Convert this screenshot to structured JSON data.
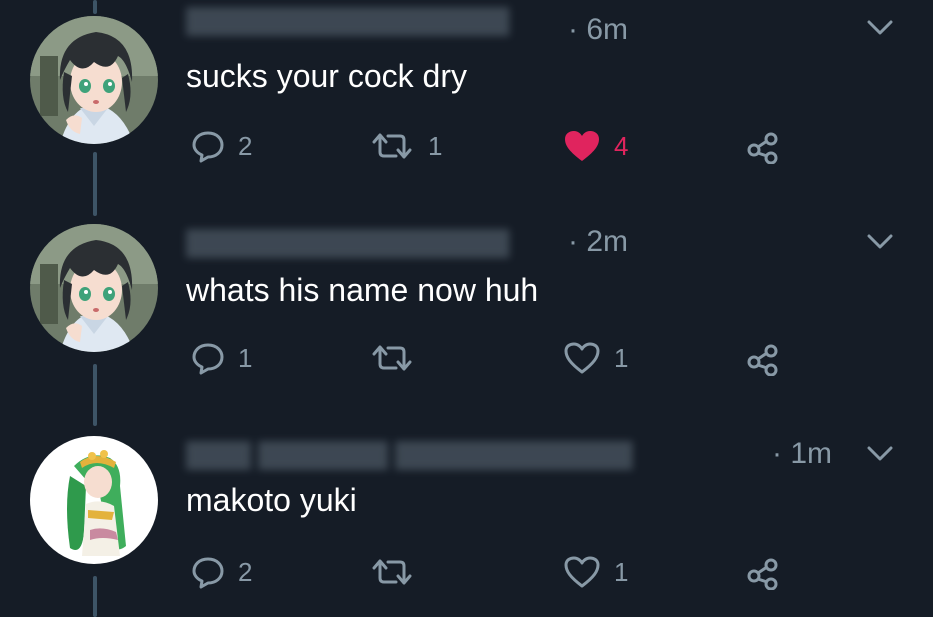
{
  "colors": {
    "background": "#151c26",
    "text": "#ffffff",
    "muted": "#8899a6",
    "like": "#e0245e",
    "thread_line": "#3d5466"
  },
  "tweets": [
    {
      "time": "· 6m",
      "text": "sucks your cock dry",
      "avatar": "anime-boy-avatar",
      "replies": "2",
      "retweets": "1",
      "likes": "4",
      "liked": true
    },
    {
      "time": "· 2m",
      "text": "whats his name now huh",
      "avatar": "anime-boy-avatar",
      "replies": "1",
      "retweets": "",
      "likes": "1",
      "liked": false
    },
    {
      "time": "· 1m",
      "text": "makoto yuki",
      "avatar": "green-hair-goddess-avatar",
      "replies": "2",
      "retweets": "",
      "likes": "1",
      "liked": false
    }
  ],
  "icons": {
    "reply": "speech-bubble-icon",
    "retweet": "retweet-arrows-icon",
    "like": "heart-icon",
    "share": "share-nodes-icon",
    "menu": "chevron-down-icon"
  }
}
